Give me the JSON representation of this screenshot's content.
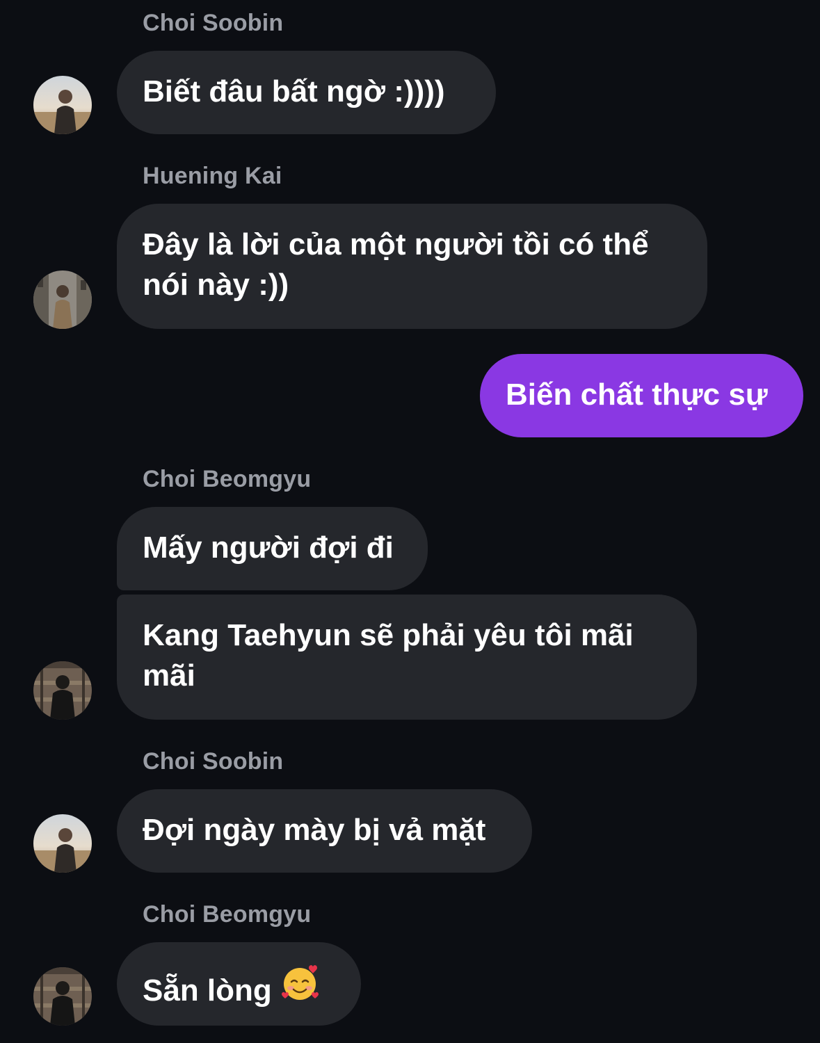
{
  "messages": [
    {
      "sender": "Choi Soobin",
      "text": "Biết đâu bất ngờ :))))"
    },
    {
      "sender": "Huening Kai",
      "text": "Đây là lời của một người tồi có thể nói này :))"
    },
    {
      "sender": "",
      "text": "Biến chất thực sự"
    },
    {
      "sender": "Choi Beomgyu",
      "text": "Mấy người đợi đi"
    },
    {
      "sender": "",
      "text": "Kang Taehyun sẽ phải yêu tôi mãi mãi"
    },
    {
      "sender": "Choi Soobin",
      "text": "Đợi ngày mày bị vả mặt"
    },
    {
      "sender": "Choi Beomgyu",
      "text": "Sẵn lòng"
    }
  ],
  "colors": {
    "background": "#0c0e13",
    "incoming_bubble": "#25272c",
    "outgoing_bubble": "#8a38e3",
    "sender_name": "#9a9da5",
    "text": "#ffffff"
  },
  "icons": {
    "emoji": "smiling-face-with-hearts-icon"
  }
}
